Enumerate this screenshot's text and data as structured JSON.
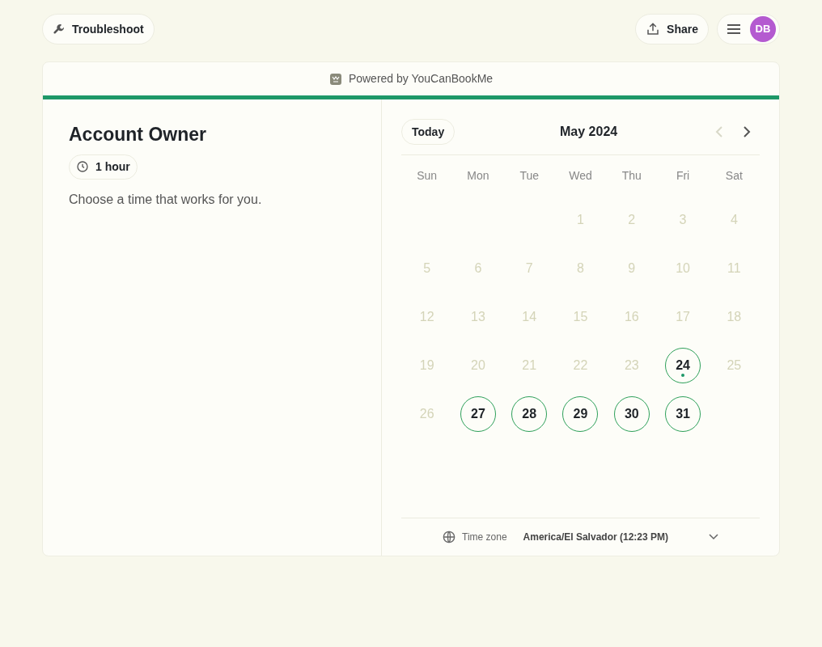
{
  "top_bar": {
    "troubleshoot": "Troubleshoot",
    "share": "Share",
    "avatar": "DB"
  },
  "card": {
    "powered_by": "Powered by YouCanBookMe",
    "title": "Account Owner",
    "duration": "1 hour",
    "instructions": "Choose a time that works for you."
  },
  "calendar": {
    "today_button": "Today",
    "month": "May 2024",
    "prev_disabled": true,
    "next_disabled": false,
    "weekdays": [
      "Sun",
      "Mon",
      "Tue",
      "Wed",
      "Thu",
      "Fri",
      "Sat"
    ],
    "weeks": [
      [
        {
          "label": "1",
          "available": false,
          "today": false
        },
        {
          "label": "2",
          "available": false,
          "today": false
        },
        {
          "label": "3",
          "available": false,
          "today": false
        },
        {
          "label": "4",
          "available": false,
          "today": false
        }
      ],
      [
        {
          "label": "5",
          "available": false,
          "today": false
        },
        {
          "label": "6",
          "available": false,
          "today": false
        },
        {
          "label": "7",
          "available": false,
          "today": false
        },
        {
          "label": "8",
          "available": false,
          "today": false
        },
        {
          "label": "9",
          "available": false,
          "today": false
        },
        {
          "label": "10",
          "available": false,
          "today": false
        },
        {
          "label": "11",
          "available": false,
          "today": false
        }
      ],
      [
        {
          "label": "12",
          "available": false,
          "today": false
        },
        {
          "label": "13",
          "available": false,
          "today": false
        },
        {
          "label": "14",
          "available": false,
          "today": false
        },
        {
          "label": "15",
          "available": false,
          "today": false
        },
        {
          "label": "16",
          "available": false,
          "today": false
        },
        {
          "label": "17",
          "available": false,
          "today": false
        },
        {
          "label": "18",
          "available": false,
          "today": false
        }
      ],
      [
        {
          "label": "19",
          "available": false,
          "today": false
        },
        {
          "label": "20",
          "available": false,
          "today": false
        },
        {
          "label": "21",
          "available": false,
          "today": false
        },
        {
          "label": "22",
          "available": false,
          "today": false
        },
        {
          "label": "23",
          "available": false,
          "today": false
        },
        {
          "label": "24",
          "available": true,
          "today": true
        },
        {
          "label": "25",
          "available": false,
          "today": false
        }
      ],
      [
        {
          "label": "26",
          "available": false,
          "today": false
        },
        {
          "label": "27",
          "available": true,
          "today": false
        },
        {
          "label": "28",
          "available": true,
          "today": false
        },
        {
          "label": "29",
          "available": true,
          "today": false
        },
        {
          "label": "30",
          "available": true,
          "today": false
        },
        {
          "label": "31",
          "available": true,
          "today": false
        }
      ]
    ],
    "timezone_label": "Time zone",
    "timezone_value": "America/El Salvador (12:23 PM)"
  }
}
